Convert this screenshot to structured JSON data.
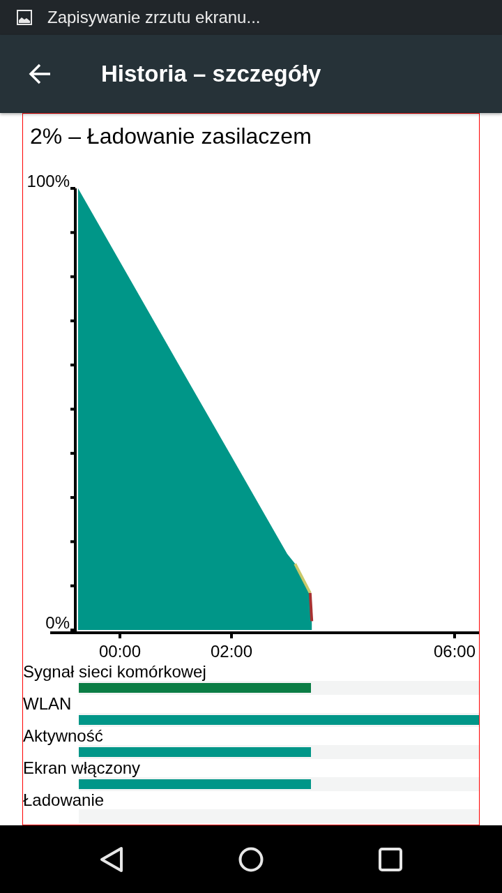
{
  "status_bar": {
    "notification": "Zapisywanie zrzutu ekranu..."
  },
  "app_bar": {
    "title": "Historia – szczegóły"
  },
  "battery": {
    "title": "2% – Ładowanie zasilaczem",
    "chart_data": {
      "type": "area",
      "x": [
        -0.75,
        0,
        1,
        2,
        3,
        3.14,
        3.41,
        3.44
      ],
      "series": [
        {
          "type": "area",
          "color": "#009688",
          "values": [
            100,
            83.4,
            61.3,
            39.3,
            17.2,
            15,
            8.4,
            2
          ]
        },
        {
          "type": "line",
          "color": "#c9c96a",
          "values": [
            null,
            null,
            null,
            null,
            null,
            15,
            8.4,
            null
          ]
        },
        {
          "type": "line",
          "color": "#a83232",
          "values": [
            null,
            null,
            null,
            null,
            null,
            null,
            8.4,
            2
          ]
        }
      ],
      "xlim": [
        -1.25,
        6.45
      ],
      "ylim": [
        0,
        100
      ],
      "xticks": [
        {
          "value": 0,
          "label": "00:00"
        },
        {
          "value": 2,
          "label": "02:00"
        },
        {
          "value": 6,
          "label": "06:00"
        }
      ],
      "yticks": [
        {
          "value": 0,
          "label": "0%"
        },
        {
          "value": 100,
          "label": "100%"
        }
      ]
    }
  },
  "timelines": [
    {
      "label": "Sygnał sieci komórkowej",
      "level": 0.58,
      "color": "#0b7d45"
    },
    {
      "label": "WLAN",
      "level": 1,
      "color": "#009688"
    },
    {
      "label": "Aktywność",
      "level": 0.58,
      "color": "#009688"
    },
    {
      "label": "Ekran włączony",
      "level": 0.58,
      "color": "#009688"
    },
    {
      "label": "Ładowanie",
      "level": 0
    }
  ]
}
